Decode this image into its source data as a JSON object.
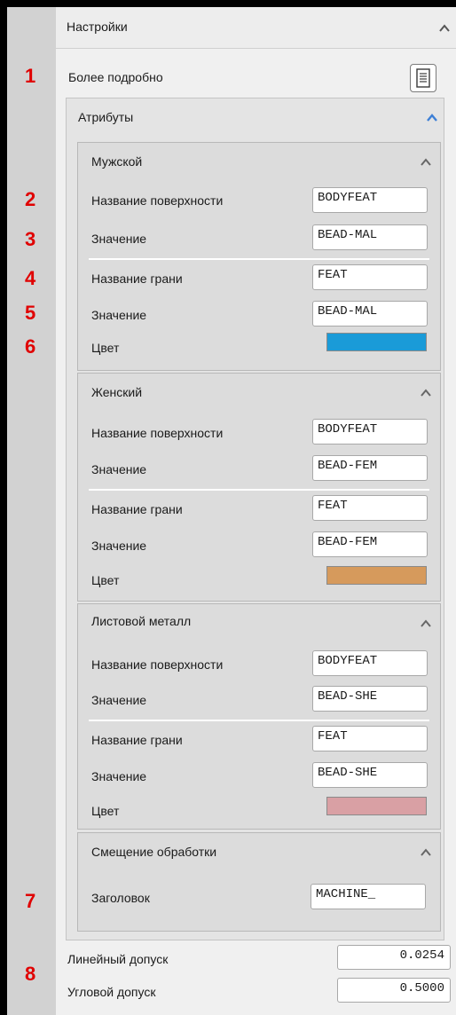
{
  "numbers": [
    "1",
    "2",
    "3",
    "4",
    "5",
    "6",
    "7",
    "8"
  ],
  "settings": {
    "title": "Настройки",
    "more_detail_label": "Более подробно",
    "attributes": {
      "title": "Атрибуты",
      "male": {
        "title": "Мужской",
        "surface_name_label": "Название поверхности",
        "surface_name_value": "BODYFEAT",
        "value1_label": "Значение",
        "value1_value": "BEAD-MAL",
        "face_name_label": "Название грани",
        "face_name_value": "FEAT",
        "value2_label": "Значение",
        "value2_value": "BEAD-MAL",
        "color_label": "Цвет",
        "color": "#1a9bd8"
      },
      "female": {
        "title": "Женский",
        "surface_name_label": "Название поверхности",
        "surface_name_value": "BODYFEAT",
        "value1_label": "Значение",
        "value1_value": "BEAD-FEM",
        "face_name_label": "Название грани",
        "face_name_value": "FEAT",
        "value2_label": "Значение",
        "value2_value": "BEAD-FEM",
        "color_label": "Цвет",
        "color": "#d69a5c"
      },
      "sheet_metal": {
        "title": "Листовой металл",
        "surface_name_label": "Название поверхности",
        "surface_name_value": "BODYFEAT",
        "value1_label": "Значение",
        "value1_value": "BEAD-SHE",
        "face_name_label": "Название грани",
        "face_name_value": "FEAT",
        "value2_label": "Значение",
        "value2_value": "BEAD-SHE",
        "color_label": "Цвет",
        "color": "#d9a0a4"
      },
      "machining_offset": {
        "title": "Смещение обработки",
        "header_label": "Заголовок",
        "header_value": "MACHINE_"
      }
    },
    "linear_tolerance_label": "Линейный допуск",
    "linear_tolerance_value": "0.0254",
    "angular_tolerance_label": "Угловой допуск",
    "angular_tolerance_value": "0.5000"
  }
}
